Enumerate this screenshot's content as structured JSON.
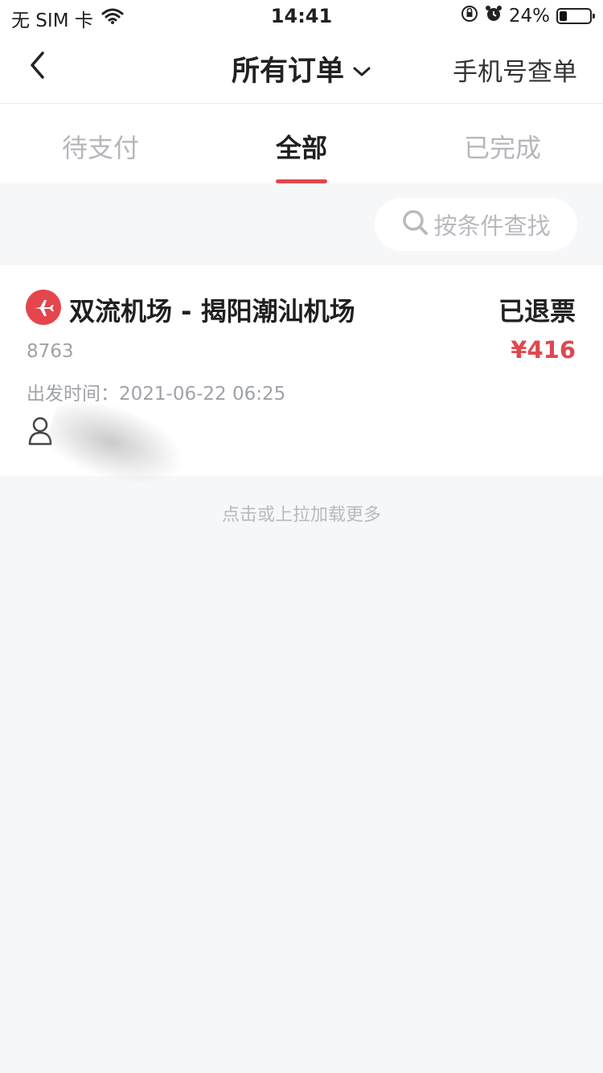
{
  "status_bar": {
    "carrier": "无 SIM 卡",
    "time": "14:41",
    "battery": "24%",
    "battery_level": 0.24,
    "icons": [
      "wifi-icon",
      "orientation-lock-icon",
      "alarm-icon",
      "battery-icon"
    ]
  },
  "nav": {
    "title": "所有订单",
    "right_label": "手机号查单",
    "icons": [
      "back-icon",
      "chevron-down-icon"
    ]
  },
  "tabs": [
    {
      "label": "待支付",
      "active": false
    },
    {
      "label": "全部",
      "active": true
    },
    {
      "label": "已完成",
      "active": false
    }
  ],
  "filter": {
    "label": "按条件查找",
    "icon": "search-icon"
  },
  "order": {
    "route": "双流机场 - 揭阳潮汕机场",
    "status": "已退票",
    "order_no": "8763",
    "price": "¥416",
    "depart_label": "出发时间：",
    "depart_time": "2021-06-22 06:25",
    "icons": [
      "plane-icon",
      "passenger-icon"
    ]
  },
  "footer": {
    "load_more": "点击或上拉加载更多"
  },
  "colors": {
    "accent": "#e0474f",
    "muted": "#9fa2a7",
    "background": "#f6f7f9"
  }
}
